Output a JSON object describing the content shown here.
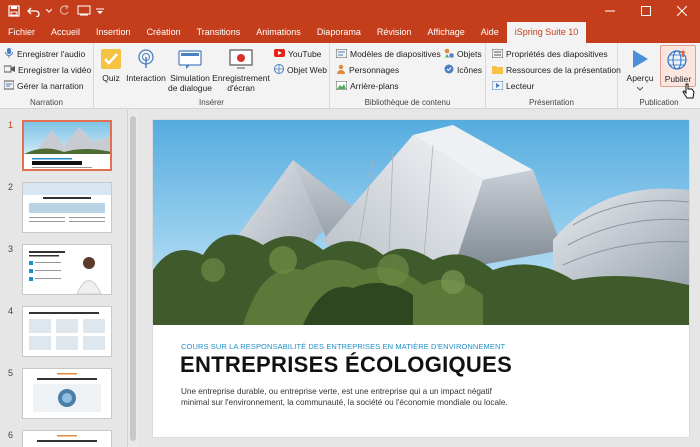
{
  "titlebar": {
    "bg": "#c43e1c",
    "qat_icons": [
      "save-icon",
      "undo-icon",
      "redo-icon",
      "touch-mode-icon",
      "customize-icon"
    ],
    "window_controls": [
      "minimize-icon",
      "maximize-icon",
      "close-icon"
    ]
  },
  "tabs": [
    {
      "label": "Fichier"
    },
    {
      "label": "Accueil"
    },
    {
      "label": "Insertion"
    },
    {
      "label": "Création"
    },
    {
      "label": "Transitions"
    },
    {
      "label": "Animations"
    },
    {
      "label": "Diaporama"
    },
    {
      "label": "Révision"
    },
    {
      "label": "Affichage"
    },
    {
      "label": "Aide"
    },
    {
      "label": "iSpring Suite 10",
      "active": true
    }
  ],
  "ribbon": {
    "narration": {
      "label": "Narration",
      "record_audio": "Enregistrer l'audio",
      "record_video": "Enregistrer la vidéo",
      "manage": "Gérer la narration"
    },
    "inserer": {
      "label": "Insérer",
      "quiz": "Quiz",
      "interaction": "Interaction",
      "simulation_1": "Simulation",
      "simulation_2": "de dialogue",
      "screen_1": "Enregistrement",
      "screen_2": "d'écran",
      "youtube": "YouTube",
      "web_object": "Objet Web"
    },
    "bibliotheque": {
      "label": "Bibliothèque de contenu",
      "templates": "Modèles de diapositives",
      "characters": "Personnages",
      "backgrounds": "Arrière-plans",
      "objects": "Objets",
      "icons": "Icônes"
    },
    "presentation": {
      "label": "Présentation",
      "properties": "Propriétés des diapositives",
      "resources": "Ressources de la présentation",
      "player": "Lecteur"
    },
    "publication": {
      "label": "Publication",
      "preview": "Aperçu",
      "publish": "Publier"
    }
  },
  "thumbnails": [
    {
      "num": "1",
      "selected": true
    },
    {
      "num": "2"
    },
    {
      "num": "3"
    },
    {
      "num": "4"
    },
    {
      "num": "5"
    },
    {
      "num": "6"
    }
  ],
  "slide": {
    "subtitle": "COURS SUR LA RESPONSABILITÉ DES ENTREPRISES EN MATIÈRE D'ENVIRONNEMENT",
    "title": "ENTREPRISES ÉCOLOGIQUES",
    "body": "Une entreprise durable, ou entreprise verte, est une entreprise qui a un impact négatif minimal sur l'environnement, la communauté, la société ou l'économie mondiale ou locale."
  }
}
